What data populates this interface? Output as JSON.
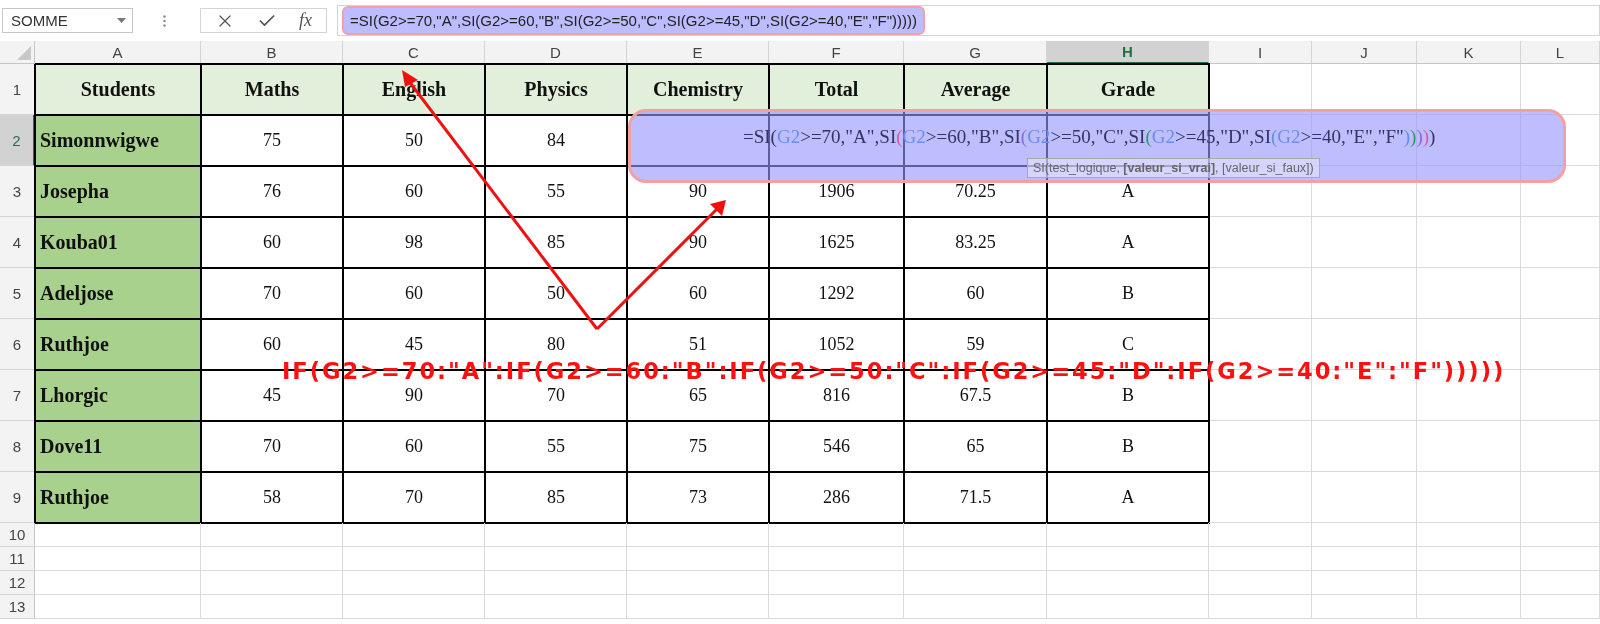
{
  "formula_bar": {
    "name_box": "SOMME",
    "function_button": "fx",
    "formula": "=SI(G2>=70,\"A\",SI(G2>=60,\"B\",SI(G2>=50,\"C\",SI(G2>=45,\"D\",SI(G2>=40,\"E\",\"F\")))))"
  },
  "column_headers": [
    {
      "label": "A",
      "selected": false
    },
    {
      "label": "B",
      "selected": false
    },
    {
      "label": "C",
      "selected": false
    },
    {
      "label": "D",
      "selected": false
    },
    {
      "label": "E",
      "selected": false
    },
    {
      "label": "F",
      "selected": false
    },
    {
      "label": "G",
      "selected": false
    },
    {
      "label": "H",
      "selected": true
    },
    {
      "label": "I",
      "selected": false
    },
    {
      "label": "J",
      "selected": false
    },
    {
      "label": "K",
      "selected": false
    },
    {
      "label": "L",
      "selected": false
    }
  ],
  "row_numbers": [
    {
      "label": "1",
      "selected": false
    },
    {
      "label": "2",
      "selected": true
    },
    {
      "label": "3",
      "selected": false
    },
    {
      "label": "4",
      "selected": false
    },
    {
      "label": "5",
      "selected": false
    },
    {
      "label": "6",
      "selected": false
    },
    {
      "label": "7",
      "selected": false
    },
    {
      "label": "8",
      "selected": false
    },
    {
      "label": "9",
      "selected": false
    },
    {
      "label": "10",
      "selected": false
    },
    {
      "label": "11",
      "selected": false
    },
    {
      "label": "12",
      "selected": false
    },
    {
      "label": "13",
      "selected": false
    }
  ],
  "table": {
    "columns": [
      "Students",
      "Maths",
      "English",
      "Physics",
      "Chemistry",
      "Total",
      "Average",
      "Grade"
    ],
    "rows": [
      [
        "Simonnwigwe",
        "75",
        "50",
        "84"
      ],
      [
        "Josepha",
        "76",
        "60",
        "55",
        "90",
        "1906",
        "70.25",
        "A"
      ],
      [
        "Kouba01",
        "60",
        "98",
        "85",
        "90",
        "1625",
        "83.25",
        "A"
      ],
      [
        "Adeljose",
        "70",
        "60",
        "50",
        "60",
        "1292",
        "60",
        "B"
      ],
      [
        "Ruthjoe",
        "60",
        "45",
        "80",
        "51",
        "1052",
        "59",
        "C"
      ],
      [
        "Lhorgic",
        "45",
        "90",
        "70",
        "65",
        "816",
        "67.5",
        "B"
      ],
      [
        "Dove11",
        "70",
        "60",
        "55",
        "75",
        "546",
        "65",
        "B"
      ],
      [
        "Ruthjoe",
        "58",
        "70",
        "85",
        "73",
        "286",
        "71.5",
        "A"
      ]
    ]
  },
  "formula_popup": {
    "segments": [
      {
        "text": "=SI(",
        "color": "#333366"
      },
      {
        "text": "G2",
        "color": "#6a8ef0"
      },
      {
        "text": ">=70,\"A\",SI",
        "color": "#333366"
      },
      {
        "text": "(",
        "color": "#d0609a"
      },
      {
        "text": "G2",
        "color": "#6a8ef0"
      },
      {
        "text": ">=60,\"B\",SI",
        "color": "#333366"
      },
      {
        "text": "(",
        "color": "#8c6ad8"
      },
      {
        "text": "G2",
        "color": "#6a8ef0"
      },
      {
        "text": ">=50,\"C\",SI",
        "color": "#333366"
      },
      {
        "text": "(",
        "color": "#2e9a6e"
      },
      {
        "text": "G2",
        "color": "#6a8ef0"
      },
      {
        "text": ">=45,\"D\",SI",
        "color": "#333366"
      },
      {
        "text": "(",
        "color": "#5f8fe0"
      },
      {
        "text": "G2",
        "color": "#6a8ef0"
      },
      {
        "text": ">=40,\"E\",\"F\"",
        "color": "#333366"
      },
      {
        "text": ")",
        "color": "#5f8fe0"
      },
      {
        "text": ")",
        "color": "#2e9a6e"
      },
      {
        "text": ")",
        "color": "#8c6ad8"
      },
      {
        "text": ")",
        "color": "#d0609a"
      },
      {
        "text": ")",
        "color": "#333366"
      }
    ],
    "tooltip": "SI(test_logique, **[valeur_si_vrai]**, [valeur_si_faux])"
  },
  "annotation": {
    "text": "IF(G2>=70:\"A\":IF(G2>=60:\"B\":IF(G2>=50:\"C\":IF(G2>=45:\"D\":IF(G2>=40:\"E\":\"F\")))))"
  }
}
